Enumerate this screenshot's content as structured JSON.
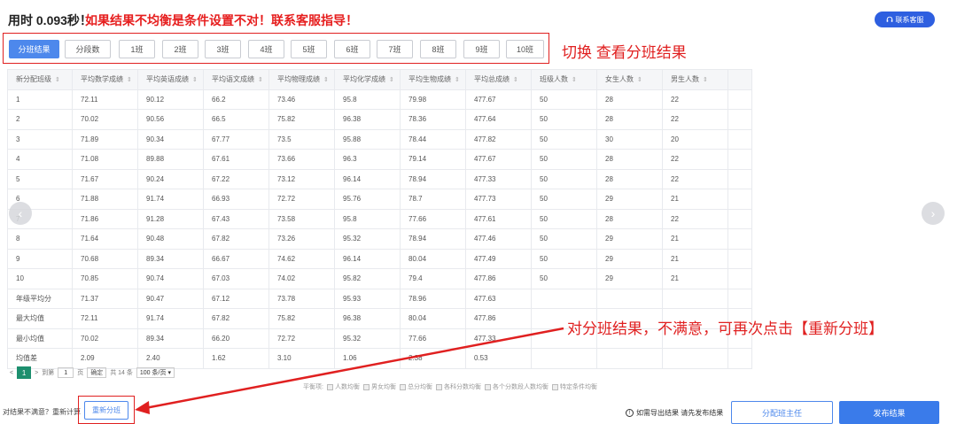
{
  "header": {
    "time_text": "用时 0.093秒！",
    "warning_text": "如果结果不均衡是条件设置不对！联系客服指导！",
    "support_button": "联系客服",
    "support_icon": "headset-icon"
  },
  "tabs": [
    {
      "label": "分班结果",
      "active": true
    },
    {
      "label": "分段数",
      "active": false
    },
    {
      "label": "1班",
      "active": false
    },
    {
      "label": "2班",
      "active": false
    },
    {
      "label": "3班",
      "active": false
    },
    {
      "label": "4班",
      "active": false
    },
    {
      "label": "5班",
      "active": false
    },
    {
      "label": "6班",
      "active": false
    },
    {
      "label": "7班",
      "active": false
    },
    {
      "label": "8班",
      "active": false
    },
    {
      "label": "9班",
      "active": false
    },
    {
      "label": "10班",
      "active": false
    }
  ],
  "annotations": {
    "switch_note": "切换 查看分班结果",
    "regroup_note": "对分班结果，不满意，可再次点击【重新分班】",
    "color": "#e02020"
  },
  "table": {
    "columns": [
      "新分配班级",
      "平均数学成绩",
      "平均英语成绩",
      "平均语文成绩",
      "平均物理成绩",
      "平均化学成绩",
      "平均生物成绩",
      "平均总成绩",
      "班级人数",
      "女生人数",
      "男生人数",
      ""
    ],
    "rows": [
      [
        "1",
        "72.11",
        "90.12",
        "66.2",
        "73.46",
        "95.8",
        "79.98",
        "477.67",
        "50",
        "28",
        "22",
        ""
      ],
      [
        "2",
        "70.02",
        "90.56",
        "66.5",
        "75.82",
        "96.38",
        "78.36",
        "477.64",
        "50",
        "28",
        "22",
        ""
      ],
      [
        "3",
        "71.89",
        "90.34",
        "67.77",
        "73.5",
        "95.88",
        "78.44",
        "477.82",
        "50",
        "30",
        "20",
        ""
      ],
      [
        "4",
        "71.08",
        "89.88",
        "67.61",
        "73.66",
        "96.3",
        "79.14",
        "477.67",
        "50",
        "28",
        "22",
        ""
      ],
      [
        "5",
        "71.67",
        "90.24",
        "67.22",
        "73.12",
        "96.14",
        "78.94",
        "477.33",
        "50",
        "28",
        "22",
        ""
      ],
      [
        "6",
        "71.88",
        "91.74",
        "66.93",
        "72.72",
        "95.76",
        "78.7",
        "477.73",
        "50",
        "29",
        "21",
        ""
      ],
      [
        "7",
        "71.86",
        "91.28",
        "67.43",
        "73.58",
        "95.8",
        "77.66",
        "477.61",
        "50",
        "28",
        "22",
        ""
      ],
      [
        "8",
        "71.64",
        "90.48",
        "67.82",
        "73.26",
        "95.32",
        "78.94",
        "477.46",
        "50",
        "29",
        "21",
        ""
      ],
      [
        "9",
        "70.68",
        "89.34",
        "66.67",
        "74.62",
        "96.14",
        "80.04",
        "477.49",
        "50",
        "29",
        "21",
        ""
      ],
      [
        "10",
        "70.85",
        "90.74",
        "67.03",
        "74.02",
        "95.82",
        "79.4",
        "477.86",
        "50",
        "29",
        "21",
        ""
      ],
      [
        "年级平均分",
        "71.37",
        "90.47",
        "67.12",
        "73.78",
        "95.93",
        "78.96",
        "477.63",
        "",
        "",
        "",
        ""
      ],
      [
        "最大均值",
        "72.11",
        "91.74",
        "67.82",
        "75.82",
        "96.38",
        "80.04",
        "477.86",
        "",
        "",
        "",
        ""
      ],
      [
        "最小均值",
        "70.02",
        "89.34",
        "66.20",
        "72.72",
        "95.32",
        "77.66",
        "477.33",
        "",
        "",
        "",
        ""
      ],
      [
        "均值差",
        "2.09",
        "2.40",
        "1.62",
        "3.10",
        "1.06",
        "2.38",
        "0.53",
        "",
        "",
        "",
        ""
      ]
    ]
  },
  "pagination": {
    "prev": "<",
    "current": "1",
    "next": ">",
    "goto_label": "到第",
    "goto_value": "1",
    "page_unit": "页",
    "confirm": "确定",
    "total": "共 14 条",
    "page_size": "100 条/页"
  },
  "balance": {
    "label": "平衡项:",
    "items": [
      "人数均衡",
      "男女均衡",
      "总分均衡",
      "各科分数均衡",
      "各个分数段人数均衡",
      "特定条件均衡"
    ]
  },
  "footer": {
    "label": "对结果不满意？重新计算",
    "regroup_button": "重新分班",
    "export_note": "如需导出结果 请先发布结果",
    "assign_button": "分配班主任",
    "publish_button": "发布结果"
  },
  "colors": {
    "primary": "#3a7bea",
    "tab_active": "#4d88ec",
    "page_active": "#1d8f6e",
    "warning": "#e61e1e"
  }
}
